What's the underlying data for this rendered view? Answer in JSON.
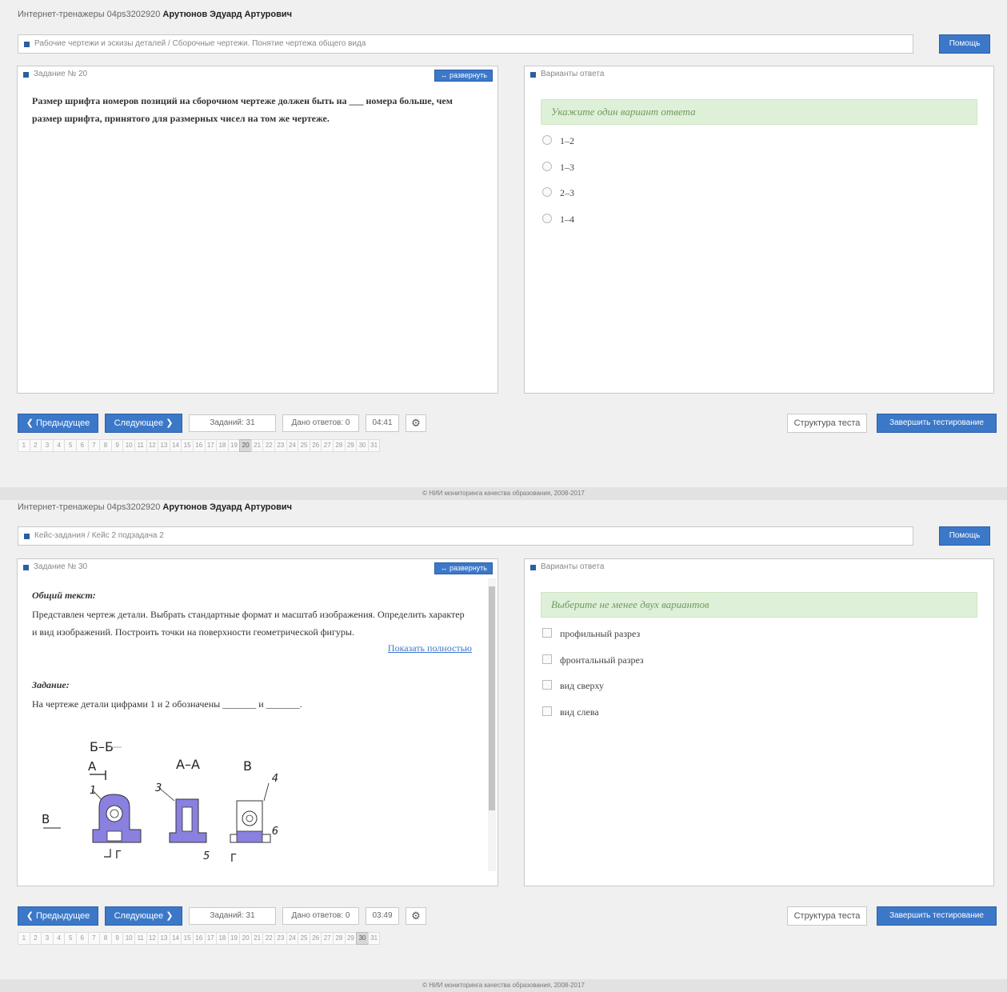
{
  "screens": [
    {
      "user_prefix": "Интернет-тренажеры 04ps3202920",
      "user_name": "Арутюнов Эдуард Артурович",
      "breadcrumb": "Рабочие чертежи и эскизы деталей / Сборочные чертежи. Понятие чертежа общего вида",
      "help_label": "Помощь",
      "task_label": "Задание № 20",
      "expand_label": "↔ развернуть",
      "question": "Размер шрифта номеров позиций на сборочном чертеже должен быть на ___ номера больше, чем размер шрифта, принятого для размерных чисел на том же чертеже.",
      "answers_label": "Варианты ответа",
      "hint": "Укажите один вариант ответа",
      "options": [
        "1–2",
        "1–3",
        "2–3",
        "1–4"
      ],
      "nav": {
        "prev": "❮ Предыдущее",
        "next": "Следующее ❯",
        "tasks": "Заданий: 31",
        "given": "Дано ответов: 0",
        "timer": "04:41",
        "structure": "Структура теста",
        "finish": "Завершить тестирование"
      },
      "pager_current": 20,
      "footer": "© НИИ мониторинга качества образования, 2008-2017"
    },
    {
      "user_prefix": "Интернет-тренажеры 04ps3202920",
      "user_name": "Арутюнов Эдуард Артурович",
      "breadcrumb": "Кейс-задания / Кейс 2 подзадача 2",
      "help_label": "Помощь",
      "task_label": "Задание № 30",
      "expand_label": "↔ развернуть",
      "common_label": "Общий текст:",
      "common_text": "Представлен чертеж детали. Выбрать стандартные формат и масштаб изображения. Определить характер и вид изображений. Построить точки на поверхности геометрической фигуры.",
      "show_full": "Показать полностью",
      "task_head": "Задание:",
      "task_text": "На чертеже детали цифрами 1 и 2 обозначены _______ и _______.",
      "answers_label": "Варианты ответа",
      "hint": "Выберите не менее двух вариантов",
      "options": [
        "профильный разрез",
        "фронтальный разрез",
        "вид сверху",
        "вид слева"
      ],
      "drawing_labels": {
        "section_bb": "Б–Б",
        "arrow_a": "А",
        "view_b": "В",
        "section_aa": "А–А",
        "view_v": "В",
        "n1": "1",
        "n3": "3",
        "n4": "4",
        "n5": "5",
        "n6": "6",
        "g_left": "Г",
        "g_right": "Г"
      },
      "nav": {
        "prev": "❮ Предыдущее",
        "next": "Следующее ❯",
        "tasks": "Заданий: 31",
        "given": "Дано ответов: 0",
        "timer": "03:49",
        "structure": "Структура теста",
        "finish": "Завершить тестирование"
      },
      "pager_current": 30,
      "footer": "© НИИ мониторинга качества образования, 2008-2017"
    }
  ],
  "pager_numbers": [
    "1",
    "2",
    "3",
    "4",
    "5",
    "6",
    "7",
    "8",
    "9",
    "10",
    "11",
    "12",
    "13",
    "14",
    "15",
    "16",
    "17",
    "18",
    "19",
    "20",
    "21",
    "22",
    "23",
    "24",
    "25",
    "26",
    "27",
    "28",
    "29",
    "30",
    "31"
  ],
  "icons": {
    "gear": "gear-icon",
    "radio": "radio-icon",
    "checkbox": "checkbox-icon"
  },
  "colors": {
    "accent": "#3c78c8",
    "hint_bg": "#dff0d8",
    "hint_text": "#6e9a5e",
    "drawing_fill": "#8a80e0"
  }
}
